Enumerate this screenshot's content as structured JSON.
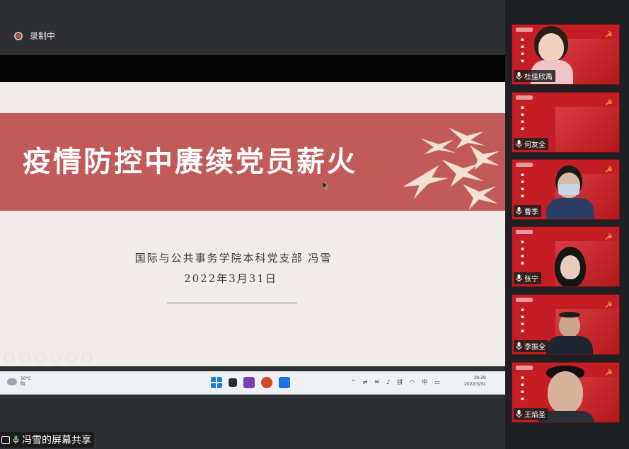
{
  "recording": {
    "label": "录制中"
  },
  "slide": {
    "title": "疫情防控中赓续党员薪火",
    "subtitle": "国际与公共事务学院本科党支部   冯雪",
    "date": "2022年3月31日"
  },
  "taskbar": {
    "weather_temp": "10°C",
    "weather_desc": "阴",
    "tray_lang1": "中",
    "tray_lang2": "拼",
    "clock_time": "19:39",
    "clock_date": "2022/3/31"
  },
  "share": {
    "label": "冯雪的屏幕共享"
  },
  "participants": [
    {
      "name": "杜佳欣禹"
    },
    {
      "name": "何友全"
    },
    {
      "name": "曹季"
    },
    {
      "name": "张宁"
    },
    {
      "name": "李振全"
    },
    {
      "name": "王焰圣"
    }
  ],
  "colors": {
    "banner": "#c25a5a",
    "tile_red": "#c41e24",
    "emblem": "#f7c53b"
  },
  "icons": [
    "record-icon",
    "share-screen-icon",
    "mic-icon",
    "windows-start-icon",
    "weather-icon",
    "emblem-icon"
  ]
}
